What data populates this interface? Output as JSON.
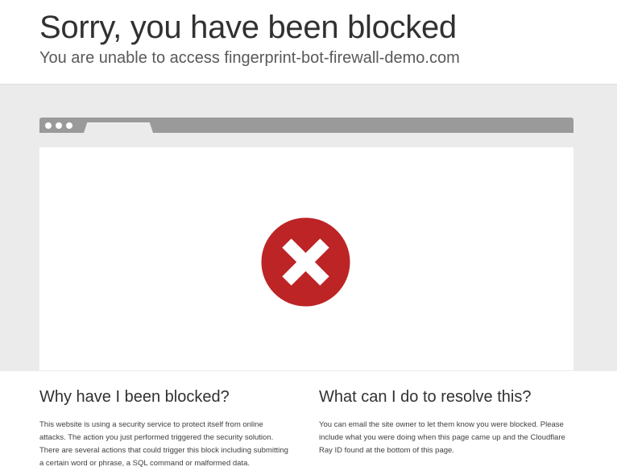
{
  "header": {
    "title": "Sorry, you have been blocked",
    "subtitle": "You are unable to access fingerprint-bot-firewall-demo.com"
  },
  "illustration": {
    "icon": "error-x-icon",
    "icon_color": "#bd2426"
  },
  "left_section": {
    "heading": "Why have I been blocked?",
    "body": "This website is using a security service to protect itself from online attacks. The action you just performed triggered the security solution. There are several actions that could trigger this block including submitting a certain word or phrase, a SQL command or malformed data."
  },
  "right_section": {
    "heading": "What can I do to resolve this?",
    "body": "You can email the site owner to let them know you were blocked. Please include what you were doing when this page came up and the Cloudflare Ray ID found at the bottom of this page."
  }
}
